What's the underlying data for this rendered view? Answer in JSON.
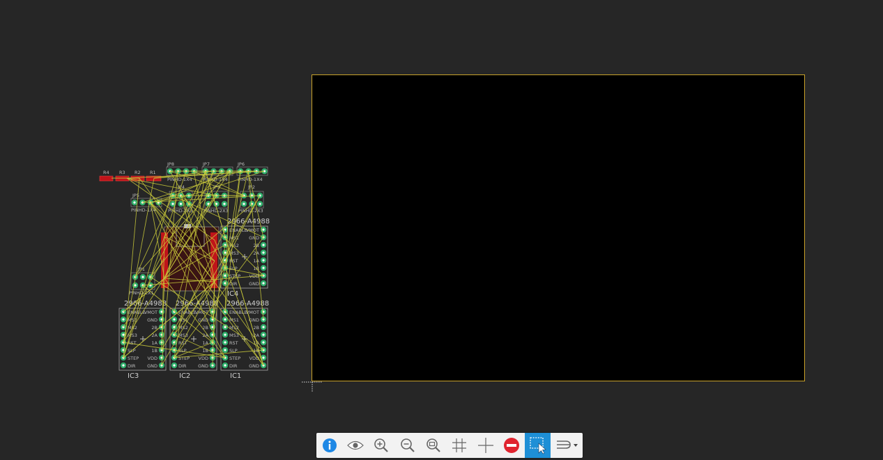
{
  "header_labels": {
    "jp8": "JP8",
    "jp7": "JP7",
    "jp6": "JP6",
    "jp5": "JP5",
    "jp1": "JP1",
    "jp2": "JP2",
    "jp3": "JP3",
    "jp4": "JP4"
  },
  "pinhead_labels": {
    "p1x4_a": "PINHD-1X4",
    "p1x4_b": "PINHD-1X4",
    "p1x4_c": "PINHD-1X4",
    "p1x4_d": "PINHD-1X4",
    "p2x3_a": "PINHD-2X3",
    "p2x3_b": "PINHD-2X3",
    "p2x3_c": "PINHD-2X3",
    "p2x1": "PINHD-2X1"
  },
  "resistor_labels": [
    "R4",
    "R3",
    "R2",
    "R1"
  ],
  "drivers": {
    "c1_title": "2966-A4988",
    "c2_title": "2966-A4988",
    "c3_title": "2966-A4988",
    "c4_title": "2966-A4988",
    "ic1": "IC1",
    "ic2": "IC2",
    "ic3": "IC3",
    "ic4": "IC4",
    "left_pins": [
      "ENABLE",
      "MS1",
      "MS2",
      "MS3",
      "RST",
      "SLP",
      "STEP",
      "DIR"
    ],
    "right_pins": [
      "VMOT",
      "GND",
      "2B",
      "2A",
      "1A",
      "1B",
      "VDD",
      "GND"
    ]
  },
  "toolbar": {
    "info_icon": "info-icon",
    "visibility_icon": "eye-icon",
    "zoom_in_icon": "zoom-in-icon",
    "zoom_out_icon": "zoom-out-icon",
    "zoom_fit_icon": "zoom-fit-icon",
    "grid_icon": "grid-icon",
    "origin_icon": "crosshair-icon",
    "stop_icon": "stop-icon",
    "select_icon": "select-icon",
    "route_icon": "route-icon"
  },
  "colors": {
    "background": "#262626",
    "board_fill": "#000000",
    "board_outline": "#c9a22a",
    "airwire": "#c8c83a",
    "pad": "#2fae6a",
    "copper_red": "#c0141a",
    "silkscreen": "#c8c8c8",
    "toolbar_active": "#1e8fd6"
  }
}
